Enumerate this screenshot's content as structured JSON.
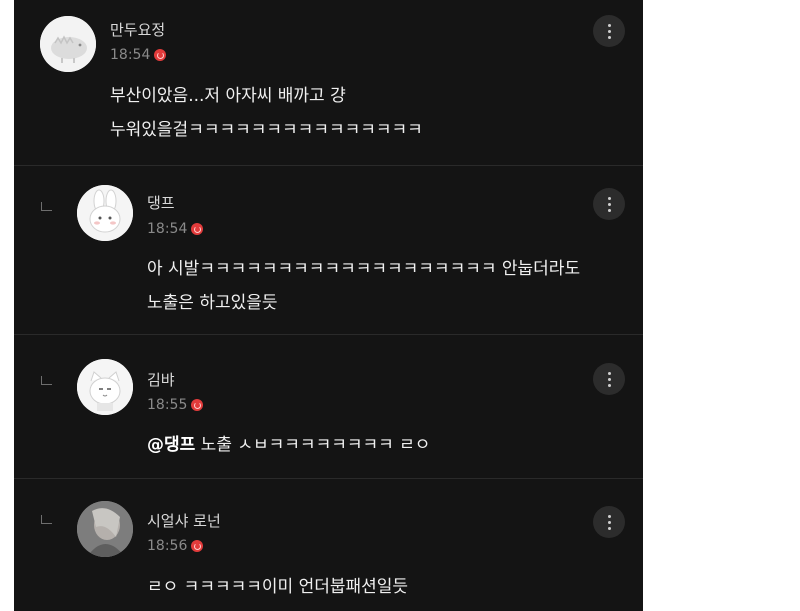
{
  "comments": [
    {
      "nickname": "만두요정",
      "time": "18:54",
      "lines": [
        "부산이았음...저 아자씨 배까고 걍",
        "누워있을걸ㅋㅋㅋㅋㅋㅋㅋㅋㅋㅋㅋㅋㅋㅋㅋ"
      ]
    },
    {
      "nickname": "댕프",
      "time": "18:54",
      "lines": [
        "아 시발ㅋㅋㅋㅋㅋㅋㅋㅋㅋㅋㅋㅋㅋㅋㅋㅋㅋㅋㅋ 안눕더라도",
        "노출은 하고있을듯"
      ]
    },
    {
      "nickname": "김뱌",
      "time": "18:55",
      "mention": "@댕프",
      "text": " 노출 ㅅㅂㅋㅋㅋㅋㅋㅋㅋㅋ ㄹㅇ"
    },
    {
      "nickname": "시얼샤 로넌",
      "time": "18:56",
      "lines": [
        "ㄹㅇ ㅋㅋㅋㅋㅋ이미 언더붑패션일듯"
      ]
    }
  ]
}
